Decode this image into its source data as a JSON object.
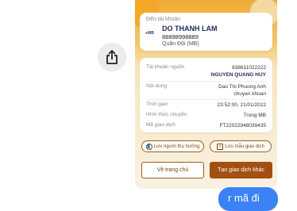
{
  "receipt": {
    "recipient_label": "Đến tài khoản",
    "recipient_name": "DO THANH LAM",
    "recipient_account": "88898998889",
    "recipient_bank": "Quân Đội (MB)",
    "bank_logo": "MB",
    "details": [
      {
        "key": "Tài khoản nguồn",
        "value1": "838611022222",
        "value2": "NGUYEN QUANG HUY"
      },
      {
        "key": "Nội dung",
        "value1": "Dao Thi Phuong Anh",
        "value2": "chuyen khoan"
      },
      {
        "key": "Thời gian",
        "value1": "23:52:00, 21/01/2022"
      },
      {
        "key": "Hình thức chuyển",
        "value1": "Trong MB"
      },
      {
        "key": "Mã giao dịch",
        "value1": "FT22022948039435"
      }
    ],
    "save_beneficiary_label": "Lưu người thụ hưởng",
    "save_template_label": "Lưu mẫu giao dịch",
    "home_label": "Về trang chủ",
    "new_transaction_label": "Tạo giao dịch khác"
  },
  "chat": {
    "message_partial": "r mã đi"
  },
  "colors": {
    "accent_brown": "#a34f12",
    "bubble_blue": "#3b82f6"
  }
}
